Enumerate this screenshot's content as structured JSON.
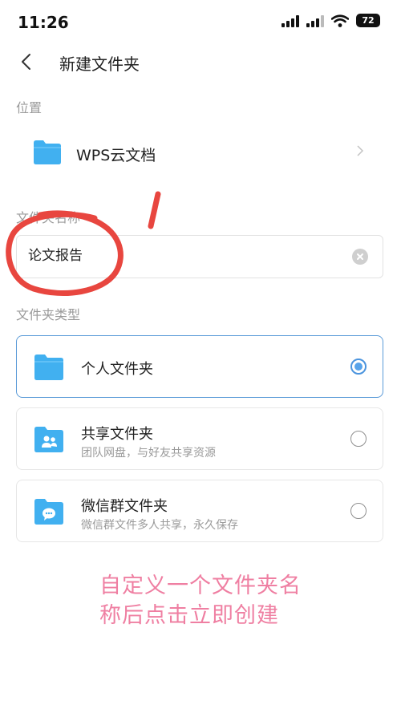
{
  "status_bar": {
    "time": "11:26",
    "battery": "72"
  },
  "nav": {
    "title": "新建文件夹"
  },
  "location": {
    "label": "位置",
    "value": "WPS云文档"
  },
  "name_section": {
    "label": "文件夹名称",
    "value": "论文报告"
  },
  "type_section": {
    "label": "文件夹类型",
    "options": [
      {
        "title": "个人文件夹",
        "subtitle": "",
        "selected": true
      },
      {
        "title": "共享文件夹",
        "subtitle": "团队网盘，与好友共享资源",
        "selected": false
      },
      {
        "title": "微信群文件夹",
        "subtitle": "微信群文件多人共享，永久保存",
        "selected": false
      }
    ]
  },
  "annotation": {
    "line1": "自定义一个文件夹名",
    "line2": "称后点击立即创建"
  },
  "colors": {
    "folder_blue": "#41b0f0",
    "annotation_pink": "#ef7fa2",
    "selected_border": "#5b9bd8"
  },
  "icons": [
    "back-icon",
    "folder-icon",
    "chevron-right-icon",
    "clear-icon",
    "shared-folder-icon",
    "wechat-folder-icon"
  ]
}
